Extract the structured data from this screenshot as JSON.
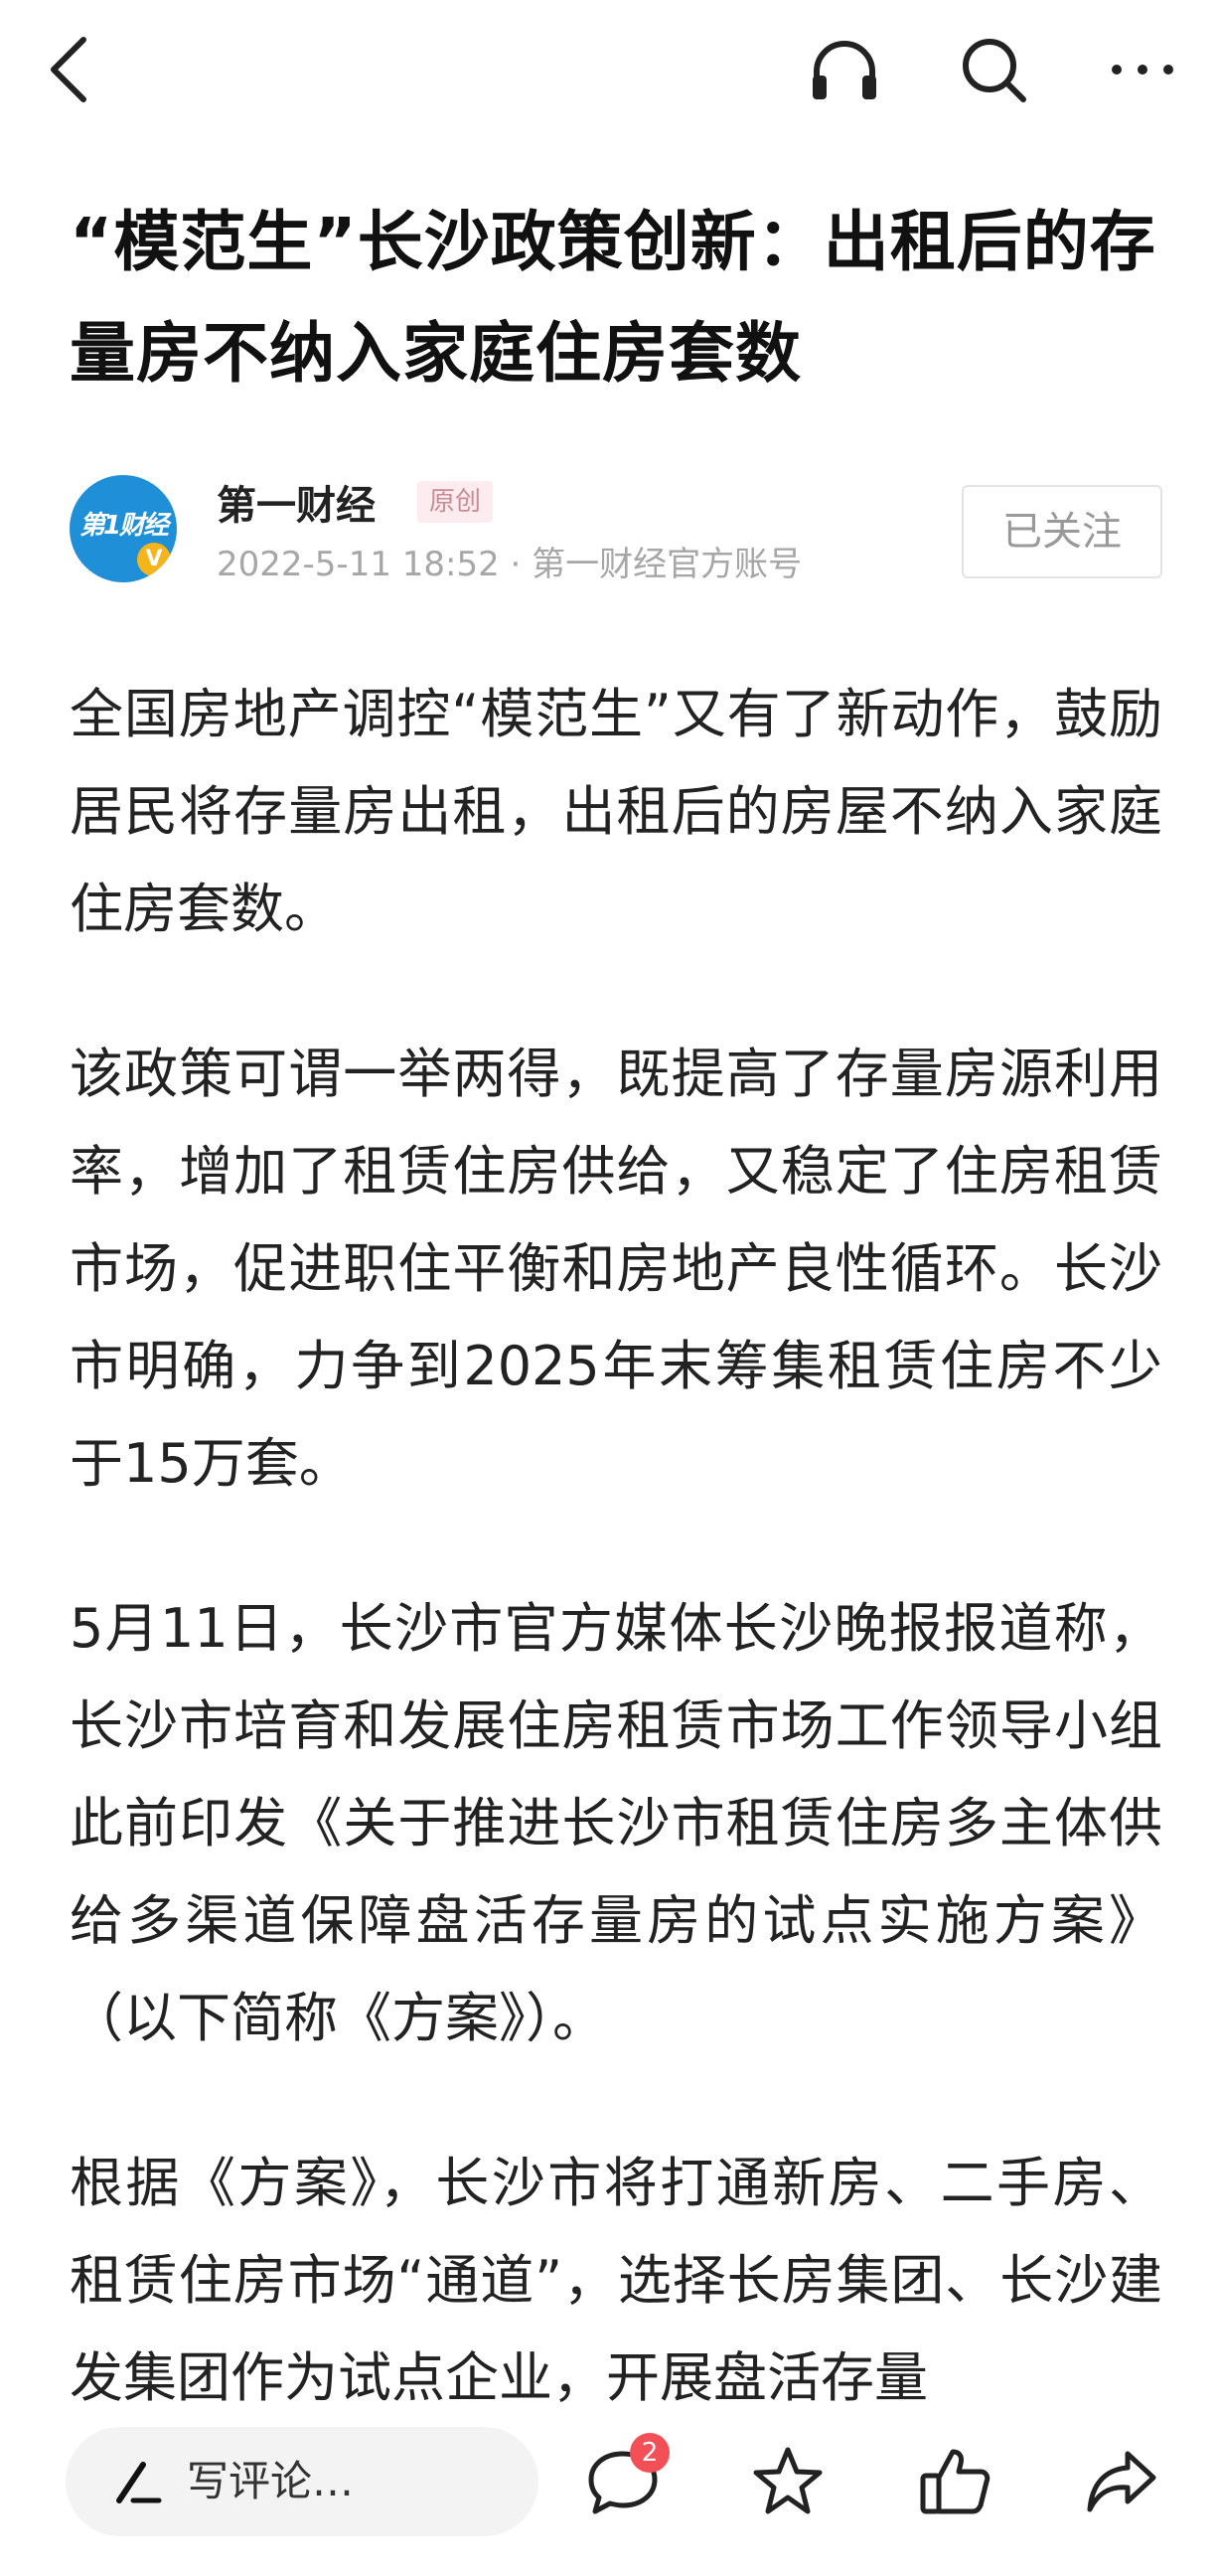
{
  "article": {
    "title": "“模范生”长沙政策创新：出租后的存量房不纳入家庭住房套数",
    "author": {
      "name": "第一财经",
      "badge": "原创",
      "meta": "2022-5-11 18:52 · 第一财经官方账号",
      "avatar_text": "第1财经",
      "avatar_mark": "V",
      "follow_label": "已关注"
    },
    "paragraphs": [
      "全国房地产调控“模范生”又有了新动作，鼓励居民将存量房出租，出租后的房屋不纳入家庭住房套数。",
      "该政策可谓一举两得，既提高了存量房源利用率，增加了租赁住房供给，又稳定了住房租赁市场，促进职住平衡和房地产良性循环。长沙市明确，力争到2025年末筹集租赁住房不少于15万套。",
      "5月11日，长沙市官方媒体长沙晚报报道称，长沙市培育和发展住房租赁市场工作领导小组此前印发《关于推进长沙市租赁住房多主体供给多渠道保障盘活存量房的试点实施方案》（以下简称《方案》）。",
      "根据《方案》，长沙市将打通新房、二手房、租赁住房市场“通道”，选择长房集团、长沙建发集团作为试点企业，开展盘活存量"
    ]
  },
  "bottom_bar": {
    "comment_placeholder": "写评论…",
    "comment_count": "2"
  },
  "icons": {
    "back": "back-arrow-icon",
    "audio": "headphones-icon",
    "search": "search-icon",
    "more": "more-icon",
    "pen": "pen-icon",
    "comment": "comment-icon",
    "favorite": "star-icon",
    "like": "thumbs-up-icon",
    "share": "share-icon"
  },
  "colors": {
    "badge_bg": "#fdecef",
    "badge_text": "#c98a95",
    "avatar_bg": "#1f8fd8",
    "count_badge": "#f25056"
  }
}
